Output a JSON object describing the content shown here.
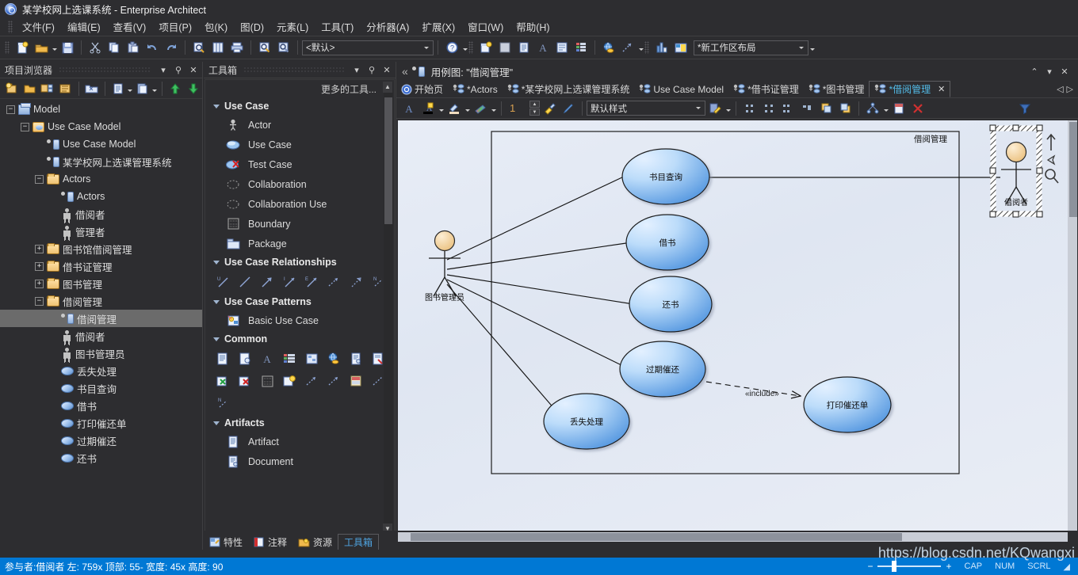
{
  "window": {
    "title": "某学校网上选课系统 - Enterprise Architect",
    "logo_icon": "app-logo-icon"
  },
  "menubar": {
    "items": [
      {
        "label": "文件(F)"
      },
      {
        "label": "编辑(E)"
      },
      {
        "label": "查看(V)"
      },
      {
        "label": "项目(P)"
      },
      {
        "label": "包(K)"
      },
      {
        "label": "图(D)"
      },
      {
        "label": "元素(L)"
      },
      {
        "label": "工具(T)"
      },
      {
        "label": "分析器(A)"
      },
      {
        "label": "扩展(X)"
      },
      {
        "label": "窗口(W)"
      },
      {
        "label": "帮助(H)"
      }
    ]
  },
  "toolbar": {
    "perspective_value": "<默认>",
    "workspace_value": "*新工作区布局",
    "buttons": [
      "new-project-icon",
      "open-project-icon",
      "save-project-icon",
      "cut-icon",
      "copy-icon",
      "paste-icon",
      "undo-icon",
      "redo-icon",
      "find-in-project-icon",
      "model-views-icon",
      "print-icon",
      "search-icon",
      "inspect-icon",
      "help-icon",
      "new-diagram-icon",
      "pattern-icon",
      "document-icon",
      "font-icon",
      "script-icon",
      "list-icon",
      "web-icon",
      "trace-icon",
      "chart-icon",
      "workspace-icon"
    ]
  },
  "browser": {
    "title": "项目浏览器",
    "toolbar_icons": [
      "new-package-icon",
      "new-view-icon",
      "new-element-icon",
      "new-diagram-icon",
      "model-search-icon",
      "documentation-icon",
      "clipboard-icon",
      "move-up-icon",
      "move-down-icon"
    ],
    "tree": [
      {
        "label": "Model",
        "level": 0,
        "expander": "minus",
        "icon": "model-icon"
      },
      {
        "label": "Use Case Model",
        "level": 1,
        "expander": "minus",
        "icon": "usecase-model-icon"
      },
      {
        "label": "Use Case Model",
        "level": 2,
        "expander": "none",
        "icon": "diagram-icon"
      },
      {
        "label": "某学校网上选课管理系统",
        "level": 2,
        "expander": "none",
        "icon": "diagram-icon"
      },
      {
        "label": "Actors",
        "level": 2,
        "expander": "minus",
        "icon": "folder-icon"
      },
      {
        "label": "Actors",
        "level": 3,
        "expander": "none",
        "icon": "diagram-icon"
      },
      {
        "label": "借阅者",
        "level": 3,
        "expander": "none",
        "icon": "actor-icon"
      },
      {
        "label": "管理者",
        "level": 3,
        "expander": "none",
        "icon": "actor-icon"
      },
      {
        "label": "图书馆借阅管理",
        "level": 2,
        "expander": "plus",
        "icon": "folder-icon"
      },
      {
        "label": "借书证管理",
        "level": 2,
        "expander": "plus",
        "icon": "folder-icon"
      },
      {
        "label": "图书管理",
        "level": 2,
        "expander": "plus",
        "icon": "folder-icon"
      },
      {
        "label": "借阅管理",
        "level": 2,
        "expander": "minus",
        "icon": "folder-icon"
      },
      {
        "label": "借阅管理",
        "level": 3,
        "expander": "none",
        "icon": "diagram-icon",
        "selected": true
      },
      {
        "label": "借阅者",
        "level": 3,
        "expander": "none",
        "icon": "actor-icon"
      },
      {
        "label": "图书管理员",
        "level": 3,
        "expander": "none",
        "icon": "actor-icon"
      },
      {
        "label": "丢失处理",
        "level": 3,
        "expander": "none",
        "icon": "usecase-icon"
      },
      {
        "label": "书目查询",
        "level": 3,
        "expander": "none",
        "icon": "usecase-icon"
      },
      {
        "label": "借书",
        "level": 3,
        "expander": "none",
        "icon": "usecase-icon"
      },
      {
        "label": "打印催还单",
        "level": 3,
        "expander": "none",
        "icon": "usecase-icon"
      },
      {
        "label": "过期催还",
        "level": 3,
        "expander": "none",
        "icon": "usecase-icon"
      },
      {
        "label": "还书",
        "level": 3,
        "expander": "none",
        "icon": "usecase-icon"
      }
    ]
  },
  "toolbox": {
    "title": "工具箱",
    "more_tools": "更多的工具...",
    "groups": [
      {
        "name": "Use Case",
        "type": "list",
        "items": [
          {
            "label": "Actor",
            "icon": "actor-icon"
          },
          {
            "label": "Use Case",
            "icon": "usecase-icon"
          },
          {
            "label": "Test Case",
            "icon": "testcase-icon"
          },
          {
            "label": "Collaboration",
            "icon": "collaboration-icon"
          },
          {
            "label": "Collaboration Use",
            "icon": "collaboration-use-icon"
          },
          {
            "label": "Boundary",
            "icon": "boundary-icon"
          },
          {
            "label": "Package",
            "icon": "package-icon"
          }
        ]
      },
      {
        "name": "Use Case Relationships",
        "type": "icons",
        "count": 8,
        "icons": [
          "use-relationship-icon",
          "association-icon",
          "generalize-icon",
          "include-icon",
          "extend-icon",
          "dependency-icon",
          "realize-icon",
          "note-link-icon"
        ]
      },
      {
        "name": "Use Case Patterns",
        "type": "list",
        "items": [
          {
            "label": "Basic Use Case",
            "icon": "pattern-icon"
          }
        ]
      },
      {
        "name": "Common",
        "type": "icons",
        "count": 17,
        "icons": [
          "note-icon",
          "constraint-icon",
          "text-icon",
          "legend-icon",
          "diagram-note-icon",
          "hyperlink-icon",
          "document-icon",
          "issue-icon",
          "defect-icon",
          "change-icon",
          "boundary-icon",
          "ui-control-icon",
          "dependency-icon",
          "trace-icon",
          "tag-icon",
          "info-flow-icon",
          "note-link-icon"
        ]
      },
      {
        "name": "Artifacts",
        "type": "list",
        "items": [
          {
            "label": "Artifact",
            "icon": "artifact-icon"
          },
          {
            "label": "Document",
            "icon": "document-icon"
          }
        ]
      }
    ],
    "bottom_tabs": [
      {
        "label": "特性",
        "icon": "properties-icon",
        "active": false
      },
      {
        "label": "注释",
        "icon": "notes-icon",
        "active": false
      },
      {
        "label": "资源",
        "icon": "resources-icon",
        "active": false
      },
      {
        "label": "工具箱",
        "icon": "toolbox-icon",
        "active": true
      }
    ]
  },
  "diagram_panel": {
    "header_title": "用例图: \"借阅管理\"",
    "tabs": [
      {
        "label": "开始页",
        "icon": "home-icon",
        "active": false
      },
      {
        "label": "*Actors",
        "icon": "diagram-icon",
        "active": false
      },
      {
        "label": "*某学校网上选课管理系统",
        "icon": "diagram-icon",
        "active": false
      },
      {
        "label": "Use Case Model",
        "icon": "diagram-icon",
        "active": false
      },
      {
        "label": "*借书证管理",
        "icon": "diagram-icon",
        "active": false
      },
      {
        "label": "*图书管理",
        "icon": "diagram-icon",
        "active": false
      },
      {
        "label": "*借阅管理",
        "icon": "diagram-icon",
        "active": true
      }
    ],
    "format_toolbar": {
      "line_width_value": "1",
      "style_value": "默认样式",
      "icons": [
        "font-color-icon",
        "fill-color-icon",
        "line-color-icon",
        "gradient-icon",
        "format-painter-icon",
        "pen-icon",
        "save-style-icon",
        "align-left-icon",
        "align-center-icon",
        "align-right-icon",
        "align-top-icon",
        "bring-front-icon",
        "send-back-icon",
        "auto-layout-icon",
        "page-setup-icon",
        "delete-icon",
        "filter-icon"
      ]
    }
  },
  "diagram": {
    "boundary_label": "借阅管理",
    "actors": [
      {
        "name": "图书管理员",
        "selected": false
      },
      {
        "name": "借阅者",
        "selected": true
      }
    ],
    "use_cases": [
      {
        "name": "书目查询"
      },
      {
        "name": "借书"
      },
      {
        "name": "还书"
      },
      {
        "name": "过期催还"
      },
      {
        "name": "丢失处理"
      },
      {
        "name": "打印催还单"
      }
    ],
    "relation_label": "«include»",
    "colors": {
      "canvas": "#e5eaf4",
      "usecase_fill_light": "#cfe4fb",
      "usecase_fill_dark": "#4e94e0",
      "actor_head": "#f3d3a0",
      "border": "#1a1a1a"
    }
  },
  "statusbar": {
    "text": "参与者:借阅者  左:  759x 顶部:  55- 宽度:  45x 高度:  90",
    "zoom_minus": "−",
    "zoom_plus": "+",
    "indicators": [
      "CAP",
      "NUM",
      "SCRL"
    ],
    "watermark": "https://blog.csdn.net/KQwangxi"
  }
}
